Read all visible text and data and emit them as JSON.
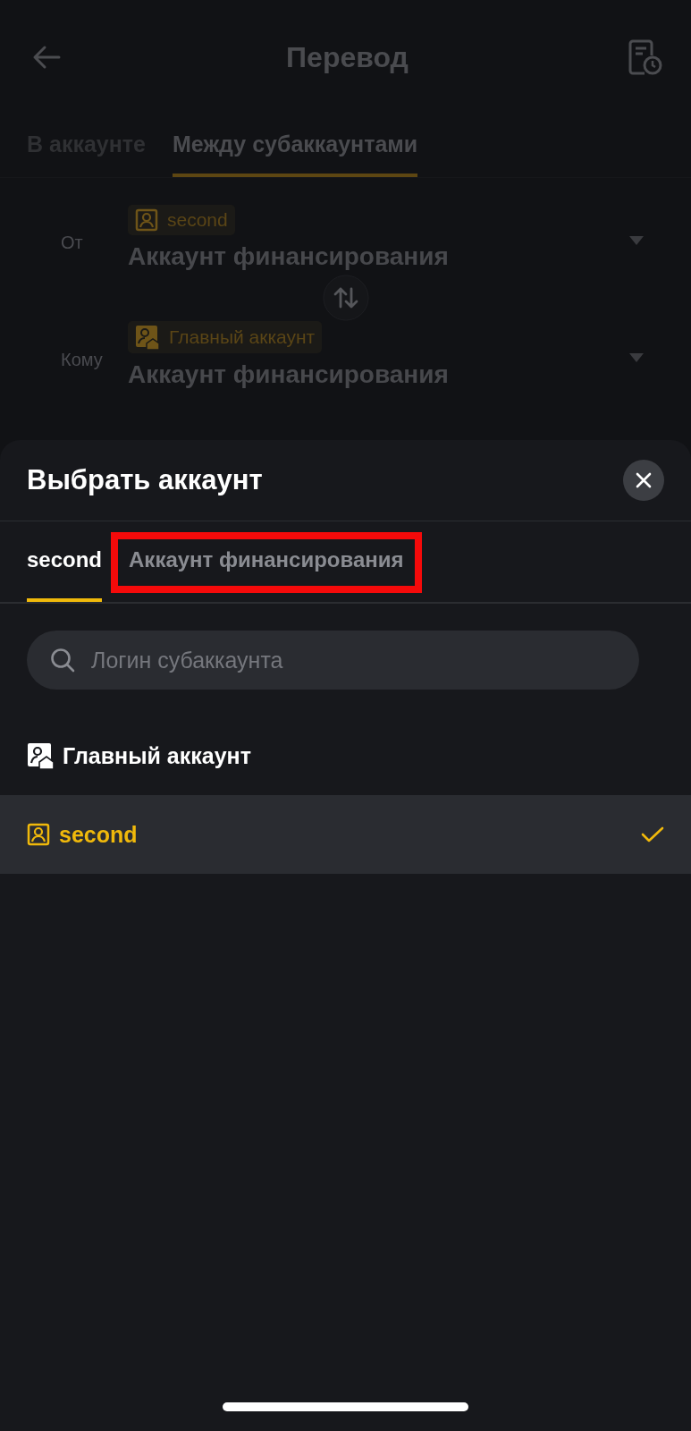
{
  "header": {
    "title": "Перевод"
  },
  "tabs": [
    {
      "label": "В аккаунте",
      "selected": false
    },
    {
      "label": "Между субаккаунтами",
      "selected": true
    }
  ],
  "transfer": [
    {
      "label": "От",
      "badge": "second",
      "kind": "sub",
      "account": "Аккаунт финансирования"
    },
    {
      "label": "Кому",
      "badge": "Главный аккаунт",
      "kind": "main",
      "account": "Аккаунт финансирования"
    }
  ],
  "sheet": {
    "title": "Выбрать аккаунт",
    "tabs": [
      {
        "label": "second",
        "selected": true,
        "highlighted": false
      },
      {
        "label": "Аккаунт финансирования",
        "selected": false,
        "highlighted": true
      }
    ],
    "search": {
      "placeholder": "Логин субаккаунта"
    },
    "accounts": [
      {
        "name": "Главный аккаунт",
        "kind": "main",
        "selected": false
      },
      {
        "name": "second",
        "kind": "sub",
        "selected": true
      }
    ]
  }
}
